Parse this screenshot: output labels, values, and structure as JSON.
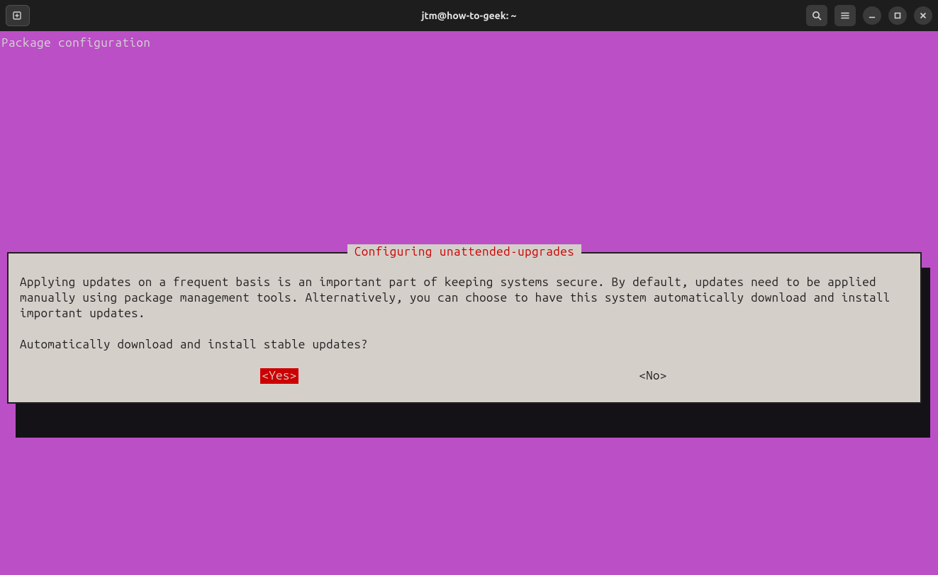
{
  "titlebar": {
    "window_title": "jtm@how-to-geek: ~"
  },
  "terminal": {
    "screen_title": "Package configuration"
  },
  "dialog": {
    "title": "Configuring unattended-upgrades",
    "paragraph": "Applying updates on a frequent basis is an important part of keeping systems secure. By default, updates need to be applied manually using package management tools. Alternatively, you can choose to have this system automatically download and install important updates.",
    "question": "Automatically download and install stable updates?",
    "yes_label": "<Yes>",
    "no_label": "<No>",
    "selected": "yes"
  }
}
